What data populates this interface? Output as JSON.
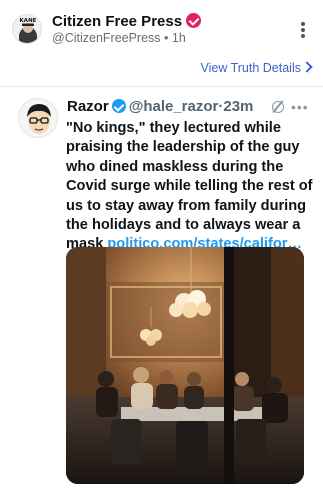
{
  "post": {
    "author_name": "Citizen Free Press",
    "author_meta": "@CitizenFreePress • 1h",
    "avatar_text": "KANE",
    "badge_color": "#e0245e",
    "view_details": "View Truth Details"
  },
  "quoted": {
    "name": "Razor",
    "handle": "@hale_razor",
    "time": "·23m",
    "text": "\"No kings,\" they lectured while praising the leadership of the guy who dined maskless during the Covid surge while telling the rest of us to stay away from family during the holidays and to always wear a mask ",
    "link": "politico.com/states/califor…",
    "badge_color": "#1d9bf0",
    "link_color": "#1d9bf0"
  },
  "icons": [
    "verified-badge-icon",
    "kebab-menu-icon",
    "chevron-right-icon",
    "blue-verified-icon",
    "mute-icon",
    "more-icon"
  ]
}
